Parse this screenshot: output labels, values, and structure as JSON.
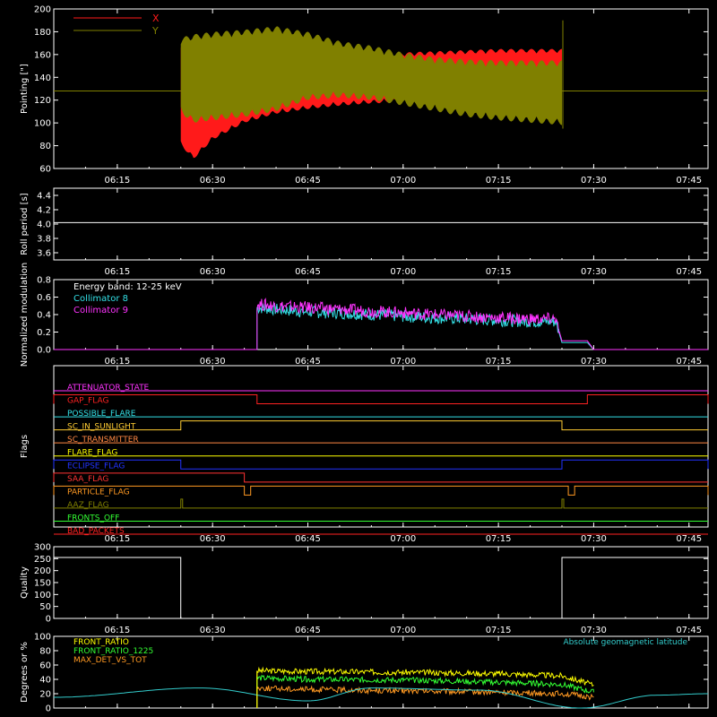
{
  "colors": {
    "background": "#000000",
    "axes": "#ffffff",
    "x_pointing": "#ff1a1a",
    "y_pointing": "#808000",
    "collimator8": "#33e0e6",
    "collimator9": "#ff33ff",
    "front_ratio": "#ffff00",
    "front_ratio_1225": "#33ff33",
    "max_det": "#ff9922",
    "geomag": "#33cccc"
  },
  "time_ticks": [
    "06:15",
    "06:30",
    "06:45",
    "07:00",
    "07:15",
    "07:30",
    "07:45"
  ],
  "chart_data": [
    {
      "type": "area",
      "ylabel": "Pointing [\"]",
      "ylim": [
        60,
        200
      ],
      "yticks": [
        "60",
        "80",
        "100",
        "120",
        "140",
        "160",
        "180",
        "200"
      ],
      "xlim": [
        "06:05",
        "07:48"
      ],
      "legend_position": "top-left",
      "series": [
        {
          "name": "X",
          "x": [
            "06:25",
            "06:27",
            "06:30",
            "06:35",
            "06:40",
            "06:45",
            "06:50",
            "06:55",
            "07:00",
            "07:05",
            "07:10",
            "07:15",
            "07:20",
            "07:25"
          ],
          "upper": [
            170,
            160,
            150,
            145,
            150,
            155,
            158,
            160,
            162,
            163,
            164,
            165,
            165,
            165
          ],
          "lower": [
            80,
            68,
            85,
            100,
            108,
            112,
            115,
            117,
            118,
            118,
            120,
            122,
            122,
            122
          ]
        },
        {
          "name": "Y",
          "x": [
            "06:25",
            "06:27",
            "06:30",
            "06:35",
            "06:40",
            "06:45",
            "06:50",
            "06:55",
            "07:00",
            "07:05",
            "07:10",
            "07:15",
            "07:20",
            "07:25"
          ],
          "upper": [
            175,
            178,
            180,
            182,
            185,
            180,
            172,
            168,
            162,
            158,
            156,
            155,
            155,
            155
          ],
          "lower": [
            108,
            100,
            102,
            105,
            110,
            120,
            122,
            120,
            115,
            110,
            105,
            102,
            100,
            98
          ]
        }
      ],
      "baseline_y": 128
    },
    {
      "type": "line",
      "ylabel": "Roll period [s]",
      "ylim": [
        3.5,
        4.5
      ],
      "yticks": [
        "3.6",
        "3.8",
        "4.0",
        "4.2",
        "4.4"
      ],
      "series": [
        {
          "name": "",
          "x": [
            "06:05",
            "07:48"
          ],
          "values": [
            4.02,
            4.02
          ]
        }
      ]
    },
    {
      "type": "line",
      "ylabel": "Normalized modulation",
      "ylim": [
        0,
        0.8
      ],
      "yticks": [
        "0.0",
        "0.2",
        "0.4",
        "0.6",
        "0.8"
      ],
      "annotation": "Energy band: 12-25 keV",
      "series": [
        {
          "name": "Collimator 8",
          "x": [
            "06:37",
            "06:40",
            "06:45",
            "06:50",
            "07:00",
            "07:10",
            "07:20",
            "07:24",
            "07:25",
            "07:29",
            "07:30"
          ],
          "values": [
            0.48,
            0.46,
            0.43,
            0.42,
            0.38,
            0.35,
            0.32,
            0.32,
            0.08,
            0.08,
            0.0
          ]
        },
        {
          "name": "Collimator 9",
          "x": [
            "06:37",
            "06:40",
            "06:45",
            "06:50",
            "07:00",
            "07:10",
            "07:20",
            "07:24",
            "07:25",
            "07:29",
            "07:30"
          ],
          "values": [
            0.52,
            0.5,
            0.48,
            0.46,
            0.42,
            0.38,
            0.35,
            0.35,
            0.1,
            0.1,
            0.0
          ]
        }
      ]
    },
    {
      "type": "line",
      "ylabel": "Flags",
      "flags": [
        {
          "name": "ATTENUATOR_STATE",
          "color": "#ff33ff",
          "high": []
        },
        {
          "name": "GAP_FLAG",
          "color": "#ff2222",
          "high": [
            [
              "06:05",
              "06:37"
            ],
            [
              "07:29",
              "07:48"
            ]
          ]
        },
        {
          "name": "POSSIBLE_FLARE",
          "color": "#33e0e6",
          "high": []
        },
        {
          "name": "SC_IN_SUNLIGHT",
          "color": "#ffcc33",
          "high": [
            [
              "06:25",
              "07:25"
            ]
          ]
        },
        {
          "name": "SC_TRANSMITTER",
          "color": "#ff8844",
          "high": []
        },
        {
          "name": "FLARE_FLAG",
          "color": "#ffff00",
          "high": []
        },
        {
          "name": "ECLIPSE_FLAG",
          "color": "#2233ff",
          "high": [
            [
              "06:05",
              "06:25"
            ],
            [
              "07:25",
              "07:48"
            ]
          ]
        },
        {
          "name": "SAA_FLAG",
          "color": "#ff3333",
          "high": [
            [
              "06:05",
              "06:35"
            ]
          ]
        },
        {
          "name": "PARTICLE_FLAG",
          "color": "#ff9922",
          "high": [
            [
              "06:05",
              "06:35"
            ],
            [
              "06:36",
              "07:26"
            ],
            [
              "07:27",
              "07:48"
            ]
          ]
        },
        {
          "name": "AAZ_FLAG",
          "color": "#808000",
          "high": [
            [
              "06:25",
              "06:25"
            ],
            [
              "07:25",
              "07:25"
            ]
          ]
        },
        {
          "name": "FRONTS_OFF",
          "color": "#33ff33",
          "high": []
        },
        {
          "name": "BAD_PACKETS",
          "color": "#ff2222",
          "high": []
        }
      ]
    },
    {
      "type": "line",
      "ylabel": "Quality",
      "ylim": [
        0,
        300
      ],
      "yticks": [
        "0",
        "50",
        "100",
        "150",
        "200",
        "250",
        "300"
      ],
      "series": [
        {
          "name": "",
          "x": [
            "06:05",
            "06:25",
            "06:25",
            "07:25",
            "07:25",
            "07:48"
          ],
          "values": [
            255,
            255,
            0,
            0,
            255,
            255
          ]
        }
      ]
    },
    {
      "type": "line",
      "ylabel": "Degrees or %",
      "ylim": [
        0,
        100
      ],
      "yticks": [
        "0",
        "20",
        "40",
        "60",
        "80",
        "100"
      ],
      "series": [
        {
          "name": "FRONT_RATIO",
          "x": [
            "06:37",
            "06:45",
            "07:00",
            "07:15",
            "07:25",
            "07:30"
          ],
          "values": [
            52,
            51,
            50,
            48,
            45,
            32
          ]
        },
        {
          "name": "FRONT_RATIO_1225",
          "x": [
            "06:37",
            "06:45",
            "07:00",
            "07:15",
            "07:25",
            "07:30"
          ],
          "values": [
            42,
            40,
            39,
            36,
            33,
            22
          ]
        },
        {
          "name": "MAX_DET_VS_TOT",
          "x": [
            "06:37",
            "06:45",
            "07:00",
            "07:15",
            "07:25",
            "07:30"
          ],
          "values": [
            28,
            26,
            24,
            22,
            20,
            15
          ]
        },
        {
          "name": "Absolute geomagnetic latitude",
          "x": [
            "06:05",
            "06:28",
            "06:45",
            "06:55",
            "07:12",
            "07:28",
            "07:40",
            "07:48"
          ],
          "values": [
            15,
            28,
            10,
            28,
            25,
            0,
            18,
            20
          ]
        }
      ]
    }
  ]
}
